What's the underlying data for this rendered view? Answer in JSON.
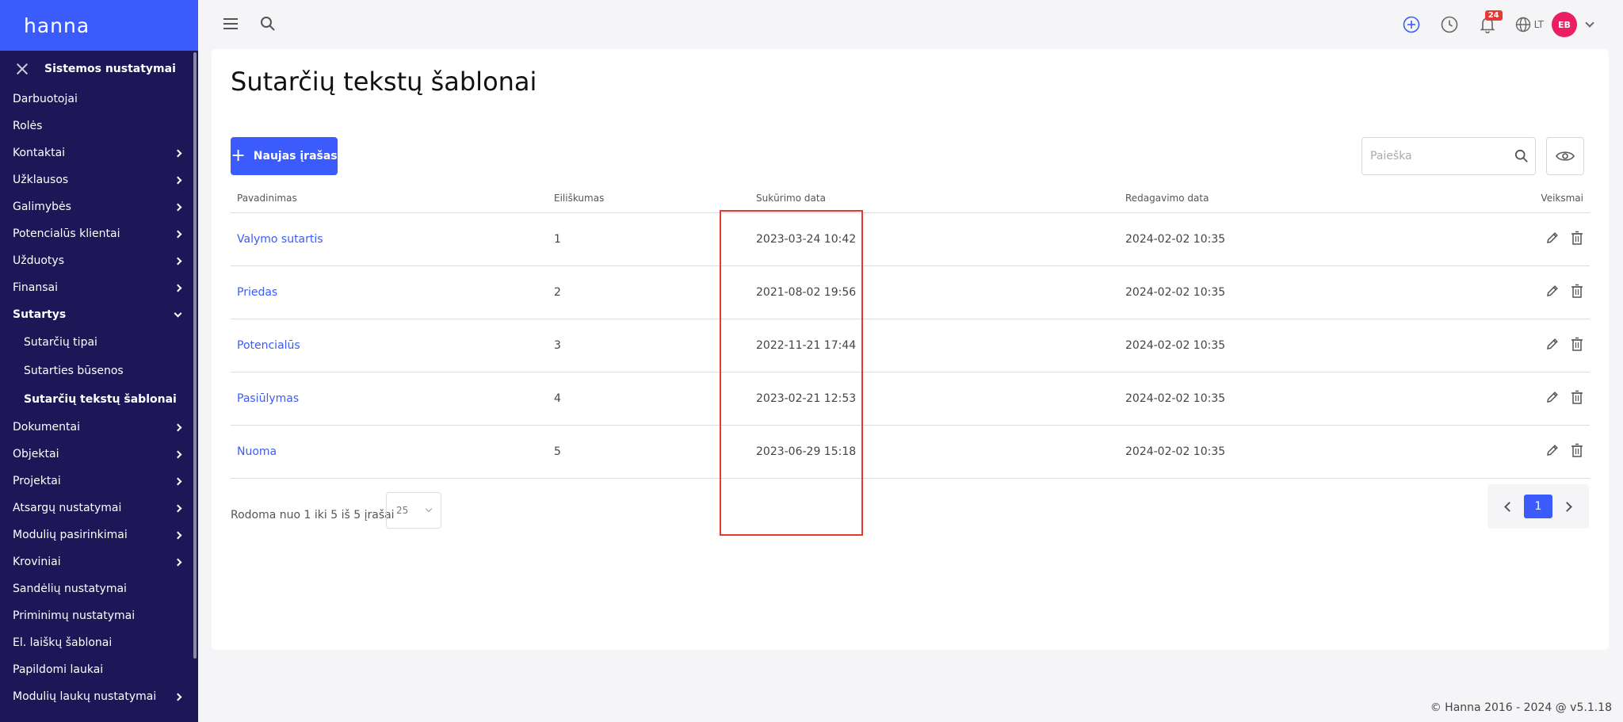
{
  "app": {
    "logo": "hanna"
  },
  "sidebar": {
    "header": "Sistemos nustatymai",
    "items": [
      {
        "label": "Darbuotojai",
        "chevron": false
      },
      {
        "label": "Rolės",
        "chevron": false
      },
      {
        "label": "Kontaktai",
        "chevron": true
      },
      {
        "label": "Užklausos",
        "chevron": true
      },
      {
        "label": "Galimybės",
        "chevron": true
      },
      {
        "label": "Potencialūs klientai",
        "chevron": true
      },
      {
        "label": "Užduotys",
        "chevron": true
      },
      {
        "label": "Finansai",
        "chevron": true
      },
      {
        "label": "Sutartys",
        "chevron": true,
        "expanded": true
      },
      {
        "label": "Sutarčių tipai",
        "sub": true
      },
      {
        "label": "Sutarties būsenos",
        "sub": true
      },
      {
        "label": "Sutarčių tekstų šablonai",
        "sub": true,
        "active": true
      },
      {
        "label": "Dokumentai",
        "chevron": true
      },
      {
        "label": "Objektai",
        "chevron": true
      },
      {
        "label": "Projektai",
        "chevron": true
      },
      {
        "label": "Atsargų nustatymai",
        "chevron": true
      },
      {
        "label": "Modulių pasirinkimai",
        "chevron": true
      },
      {
        "label": "Kroviniai",
        "chevron": true
      },
      {
        "label": "Sandėlių nustatymai",
        "chevron": false
      },
      {
        "label": "Priminimų nustatymai",
        "chevron": false
      },
      {
        "label": "El. laiškų šablonai",
        "chevron": false
      },
      {
        "label": "Papildomi laukai",
        "chevron": false
      },
      {
        "label": "Modulių laukų nustatymai",
        "chevron": true
      }
    ]
  },
  "topbar": {
    "notifications_count": "24",
    "language": "LT",
    "avatar_initials": "EB",
    "colors": {
      "add": "#3b5bfc",
      "avatar": "#e91e63",
      "badge": "#e53935"
    }
  },
  "main": {
    "title": "Sutarčių tekstų šablonai",
    "new_button_label": "Naujas įrašas",
    "search_placeholder": "Paieška",
    "columns": [
      "Pavadinimas",
      "Eiliškumas",
      "Sukūrimo data",
      "Redagavimo data",
      "Veiksmai"
    ],
    "rows": [
      {
        "name": "Valymo sutartis",
        "order": "1",
        "created": "2023-03-24 10:42",
        "edited": "2024-02-02 10:35"
      },
      {
        "name": "Priedas",
        "order": "2",
        "created": "2021-08-02 19:56",
        "edited": "2024-02-02 10:35"
      },
      {
        "name": "Potencialūs",
        "order": "3",
        "created": "2022-11-21 17:44",
        "edited": "2024-02-02 10:35"
      },
      {
        "name": "Pasiūlymas",
        "order": "4",
        "created": "2023-02-21 12:53",
        "edited": "2024-02-02 10:35"
      },
      {
        "name": "Nuoma",
        "order": "5",
        "created": "2023-06-29 15:18",
        "edited": "2024-02-02 10:35"
      }
    ],
    "pagination": {
      "info": "Rodoma nuo 1 iki 5 iš 5 įrašai",
      "page_size": "25",
      "current_page": "1"
    }
  },
  "footer": {
    "text": "© Hanna 2016 - 2024 @ v5.1.18"
  }
}
